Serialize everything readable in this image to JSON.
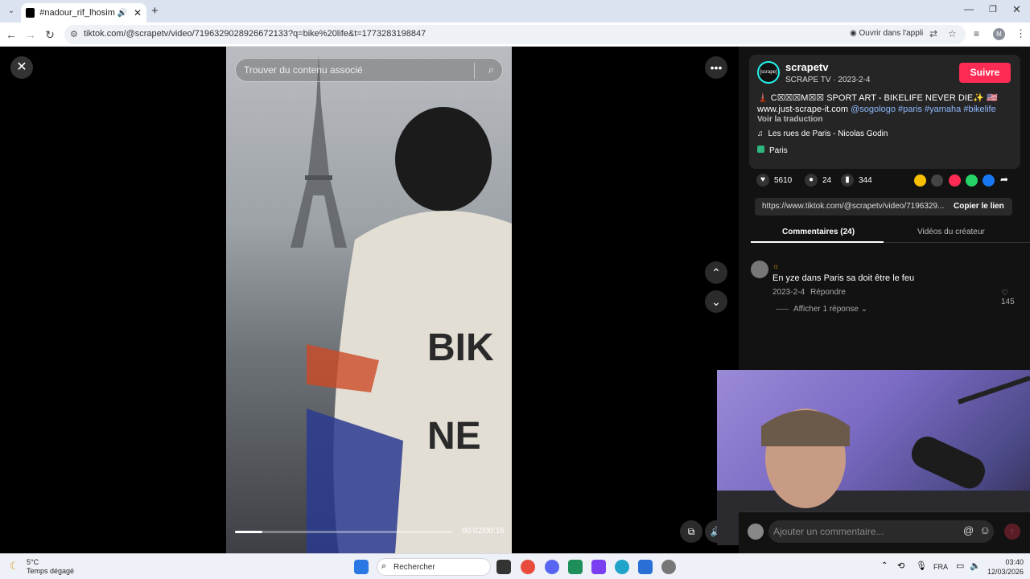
{
  "browser": {
    "tab_title": "#nadour_rif_lhosima #imzo",
    "url": "tiktok.com/@scrapetv/video/7196329028926672133?q=bike%20life&t=1773283198847",
    "open_in_app": "Ouvrir dans l'appli"
  },
  "video": {
    "search_placeholder": "Trouver du contenu associé",
    "time": "00:02/00:16",
    "progress": 0.125
  },
  "post": {
    "username": "scrapetv",
    "avatar_text": "[scrape]",
    "subline": "SCRAPE TV · 2023-2-4",
    "follow_label": "Suivre",
    "caption_line1": "🗼 C☒☒☒M☒☒ SPORT ART - BIKELIFE NEVER DIE✨ 🇺🇸",
    "caption_url": "www.just-scrape-it.com",
    "caption_tags": "@sogologo #paris #yamaha #bikelife",
    "translate": "Voir la traduction",
    "music": "Les rues de Paris - Nicolas Godin",
    "place": "Paris"
  },
  "stats": {
    "likes": "5610",
    "comments": "24",
    "saves": "344"
  },
  "share_colors": [
    "#f6c000",
    "#444444",
    "#fe2c55",
    "#25d366",
    "#1877f2"
  ],
  "link": {
    "url": "https://www.tiktok.com/@scrapetv/video/7196329...",
    "copy_label": "Copier le lien"
  },
  "tabs": {
    "comments": "Commentaires (24)",
    "creator": "Vidéos du créateur"
  },
  "comment": {
    "emoji": "☼",
    "text": "En yze dans Paris sa doit être le feu",
    "date": "2023-2-4",
    "reply": "Répondre",
    "likes": "145",
    "more": "Afficher 1 réponse"
  },
  "compose": {
    "placeholder": "Ajouter un commentaire..."
  },
  "taskbar": {
    "temp": "5°C",
    "weather": "Temps dégagé",
    "search": "Rechercher",
    "lang": "FRA",
    "time": "03:40",
    "date": "12/03/2026"
  }
}
